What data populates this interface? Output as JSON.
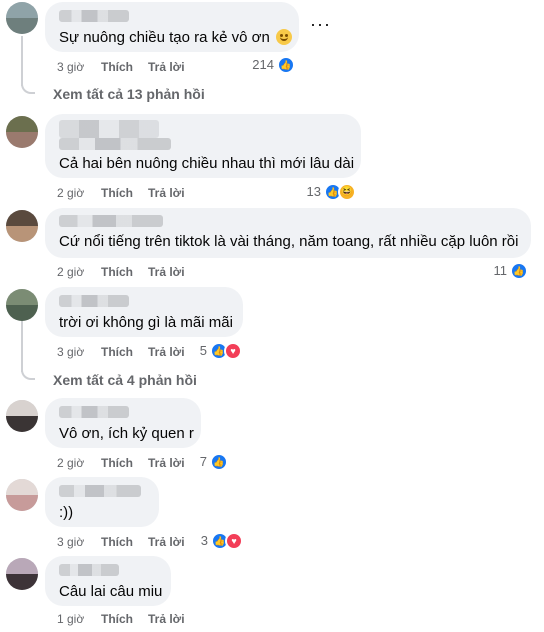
{
  "comments": [
    {
      "text": "Sự nuông chiều tạo ra kẻ vô ơn",
      "time": "3 giờ",
      "like": "Thích",
      "reply": "Trả lời",
      "reaction_count": "214",
      "reactions": [
        "like-icon"
      ],
      "view_replies": "Xem tất cả 13 phản hồi",
      "more": "···",
      "avatar_colors": [
        "#8fa3a8",
        "#6e7f7d"
      ]
    },
    {
      "text": "Cả hai bên nuông chiều nhau thì mới lâu dài",
      "time": "2 giờ",
      "like": "Thích",
      "reply": "Trả lời",
      "reaction_count": "13",
      "reactions": [
        "like-icon",
        "haha-icon"
      ],
      "avatar_colors": [
        "#6b6f4e",
        "#9a7a6e"
      ]
    },
    {
      "text": "Cứ nổi tiếng trên tiktok là vài tháng, năm toang, rất nhiều cặp luôn rồi",
      "time": "2 giờ",
      "like": "Thích",
      "reply": "Trả lời",
      "reaction_count": "11",
      "reactions": [
        "like-icon"
      ],
      "avatar_colors": [
        "#5a4a3e",
        "#b89478"
      ]
    },
    {
      "text": "trời ơi không gì là mãi mãi",
      "time": "3 giờ",
      "like": "Thích",
      "reply": "Trả lời",
      "reaction_count": "5",
      "reactions": [
        "like-icon",
        "heart-icon"
      ],
      "view_replies": "Xem tất cả 4 phản hồi",
      "avatar_colors": [
        "#7b8c74",
        "#4e6150"
      ]
    },
    {
      "text": "Vô ơn, ích kỷ quen r",
      "time": "2 giờ",
      "like": "Thích",
      "reply": "Trả lời",
      "reaction_count": "7",
      "reactions": [
        "like-icon"
      ],
      "avatar_colors": [
        "#d8d2cf",
        "#3a3434"
      ]
    },
    {
      "text": ":))",
      "time": "3 giờ",
      "like": "Thích",
      "reply": "Trả lời",
      "reaction_count": "3",
      "reactions": [
        "like-icon",
        "heart-icon"
      ],
      "avatar_colors": [
        "#e3d9d6",
        "#c79b9a"
      ]
    },
    {
      "text": "Câu lai câu miu",
      "time": "1 giờ",
      "like": "Thích",
      "reply": "Trả lời",
      "avatar_colors": [
        "#b9a8b8",
        "#3d3338"
      ]
    }
  ],
  "colors": {
    "like": "#1877f2",
    "heart": "#f33e58",
    "haha": "#f7b125",
    "bubble": "#f0f2f5",
    "meta_text": "#65676b"
  }
}
